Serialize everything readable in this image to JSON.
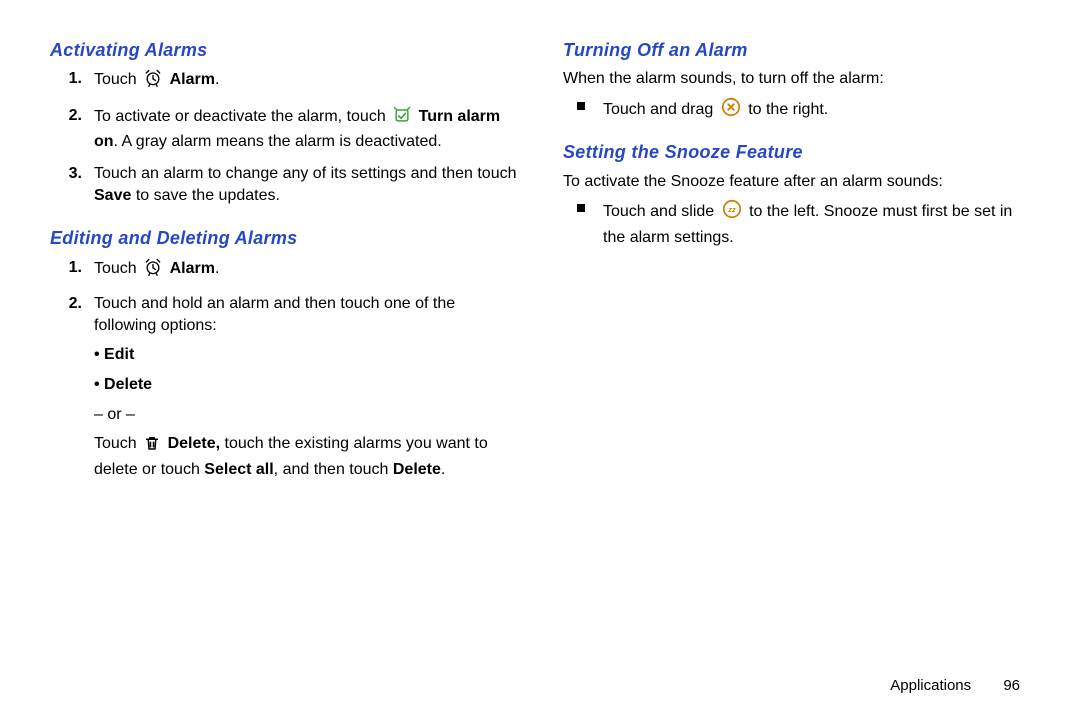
{
  "left": {
    "sec1": {
      "title": "Activating Alarms",
      "steps": [
        {
          "n": "1.",
          "pre": "Touch ",
          "iconAfter": " ",
          "boldTail": "Alarm",
          "tail": "."
        },
        {
          "n": "2.",
          "line1": "To activate or deactivate the alarm, touch ",
          "boldMid": "Turn alarm on",
          "line1b": ". A gray alarm means the alarm is deactivated."
        },
        {
          "n": "3.",
          "plain": "Touch an alarm to change any of its settings and then touch ",
          "boldMid": "Save",
          "plainTail": " to save the updates."
        }
      ]
    },
    "sec2": {
      "title": "Editing and Deleting Alarms",
      "steps": {
        "s1": {
          "n": "1.",
          "pre": "Touch ",
          "boldTail": "Alarm",
          "tail": "."
        },
        "s2": {
          "n": "2.",
          "lead": "Touch and hold an alarm and then touch one of the following options:",
          "b1": "Edit",
          "b2": "Delete",
          "or": "– or –",
          "after1": "Touch ",
          "afterBold1": "Delete,",
          "after2": " touch the existing alarms you want to delete or touch ",
          "afterBold2": "Select all",
          "after3": ", and then touch ",
          "afterBold3": "Delete",
          "after4": "."
        }
      }
    }
  },
  "right": {
    "sec1": {
      "title": "Turning Off an Alarm",
      "intro": "When the alarm sounds, to turn off the alarm:",
      "bullet": {
        "pre": "Touch and drag ",
        "post": " to the right."
      }
    },
    "sec2": {
      "title": "Setting the Snooze Feature",
      "intro": "To activate the Snooze feature after an alarm sounds:",
      "bullet": {
        "pre": "Touch and slide ",
        "post": " to the left. Snooze must first be set in the alarm settings."
      }
    }
  },
  "footer": {
    "section": "Applications",
    "page": "96"
  }
}
